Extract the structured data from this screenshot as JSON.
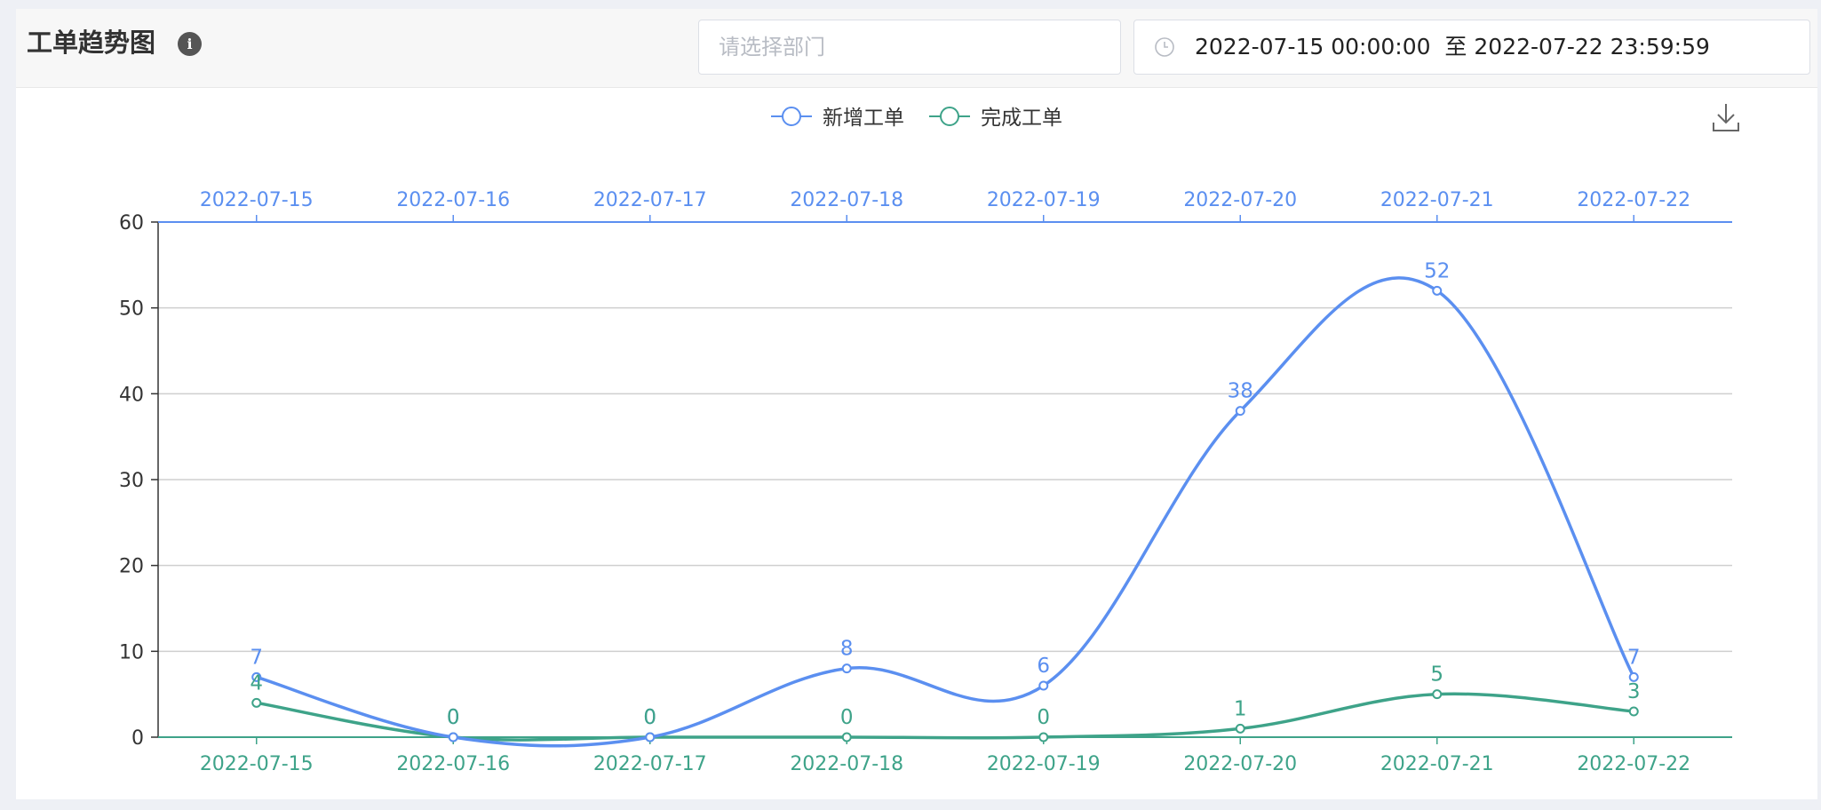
{
  "header": {
    "title": "工单趋势图",
    "info_icon": "info-icon",
    "department_placeholder": "请选择部门",
    "date_start": "2022-07-15 00:00:00",
    "date_separator": "至",
    "date_end": "2022-07-22 23:59:59"
  },
  "toolbox": {
    "download_icon": "download-icon"
  },
  "chart_data": {
    "type": "line",
    "smooth": true,
    "categories": [
      "2022-07-15",
      "2022-07-16",
      "2022-07-17",
      "2022-07-18",
      "2022-07-19",
      "2022-07-20",
      "2022-07-21",
      "2022-07-22"
    ],
    "series": [
      {
        "name": "新增工单",
        "color": "#5b8ff0",
        "values": [
          7,
          0,
          0,
          8,
          6,
          38,
          52,
          7
        ]
      },
      {
        "name": "完成工单",
        "color": "#3ea389",
        "values": [
          4,
          0,
          0,
          0,
          0,
          1,
          5,
          3
        ]
      }
    ],
    "ylim": [
      0,
      60
    ],
    "yticks": [
      0,
      10,
      20,
      30,
      40,
      50,
      60
    ],
    "grid": true,
    "legend_position": "top-center"
  }
}
